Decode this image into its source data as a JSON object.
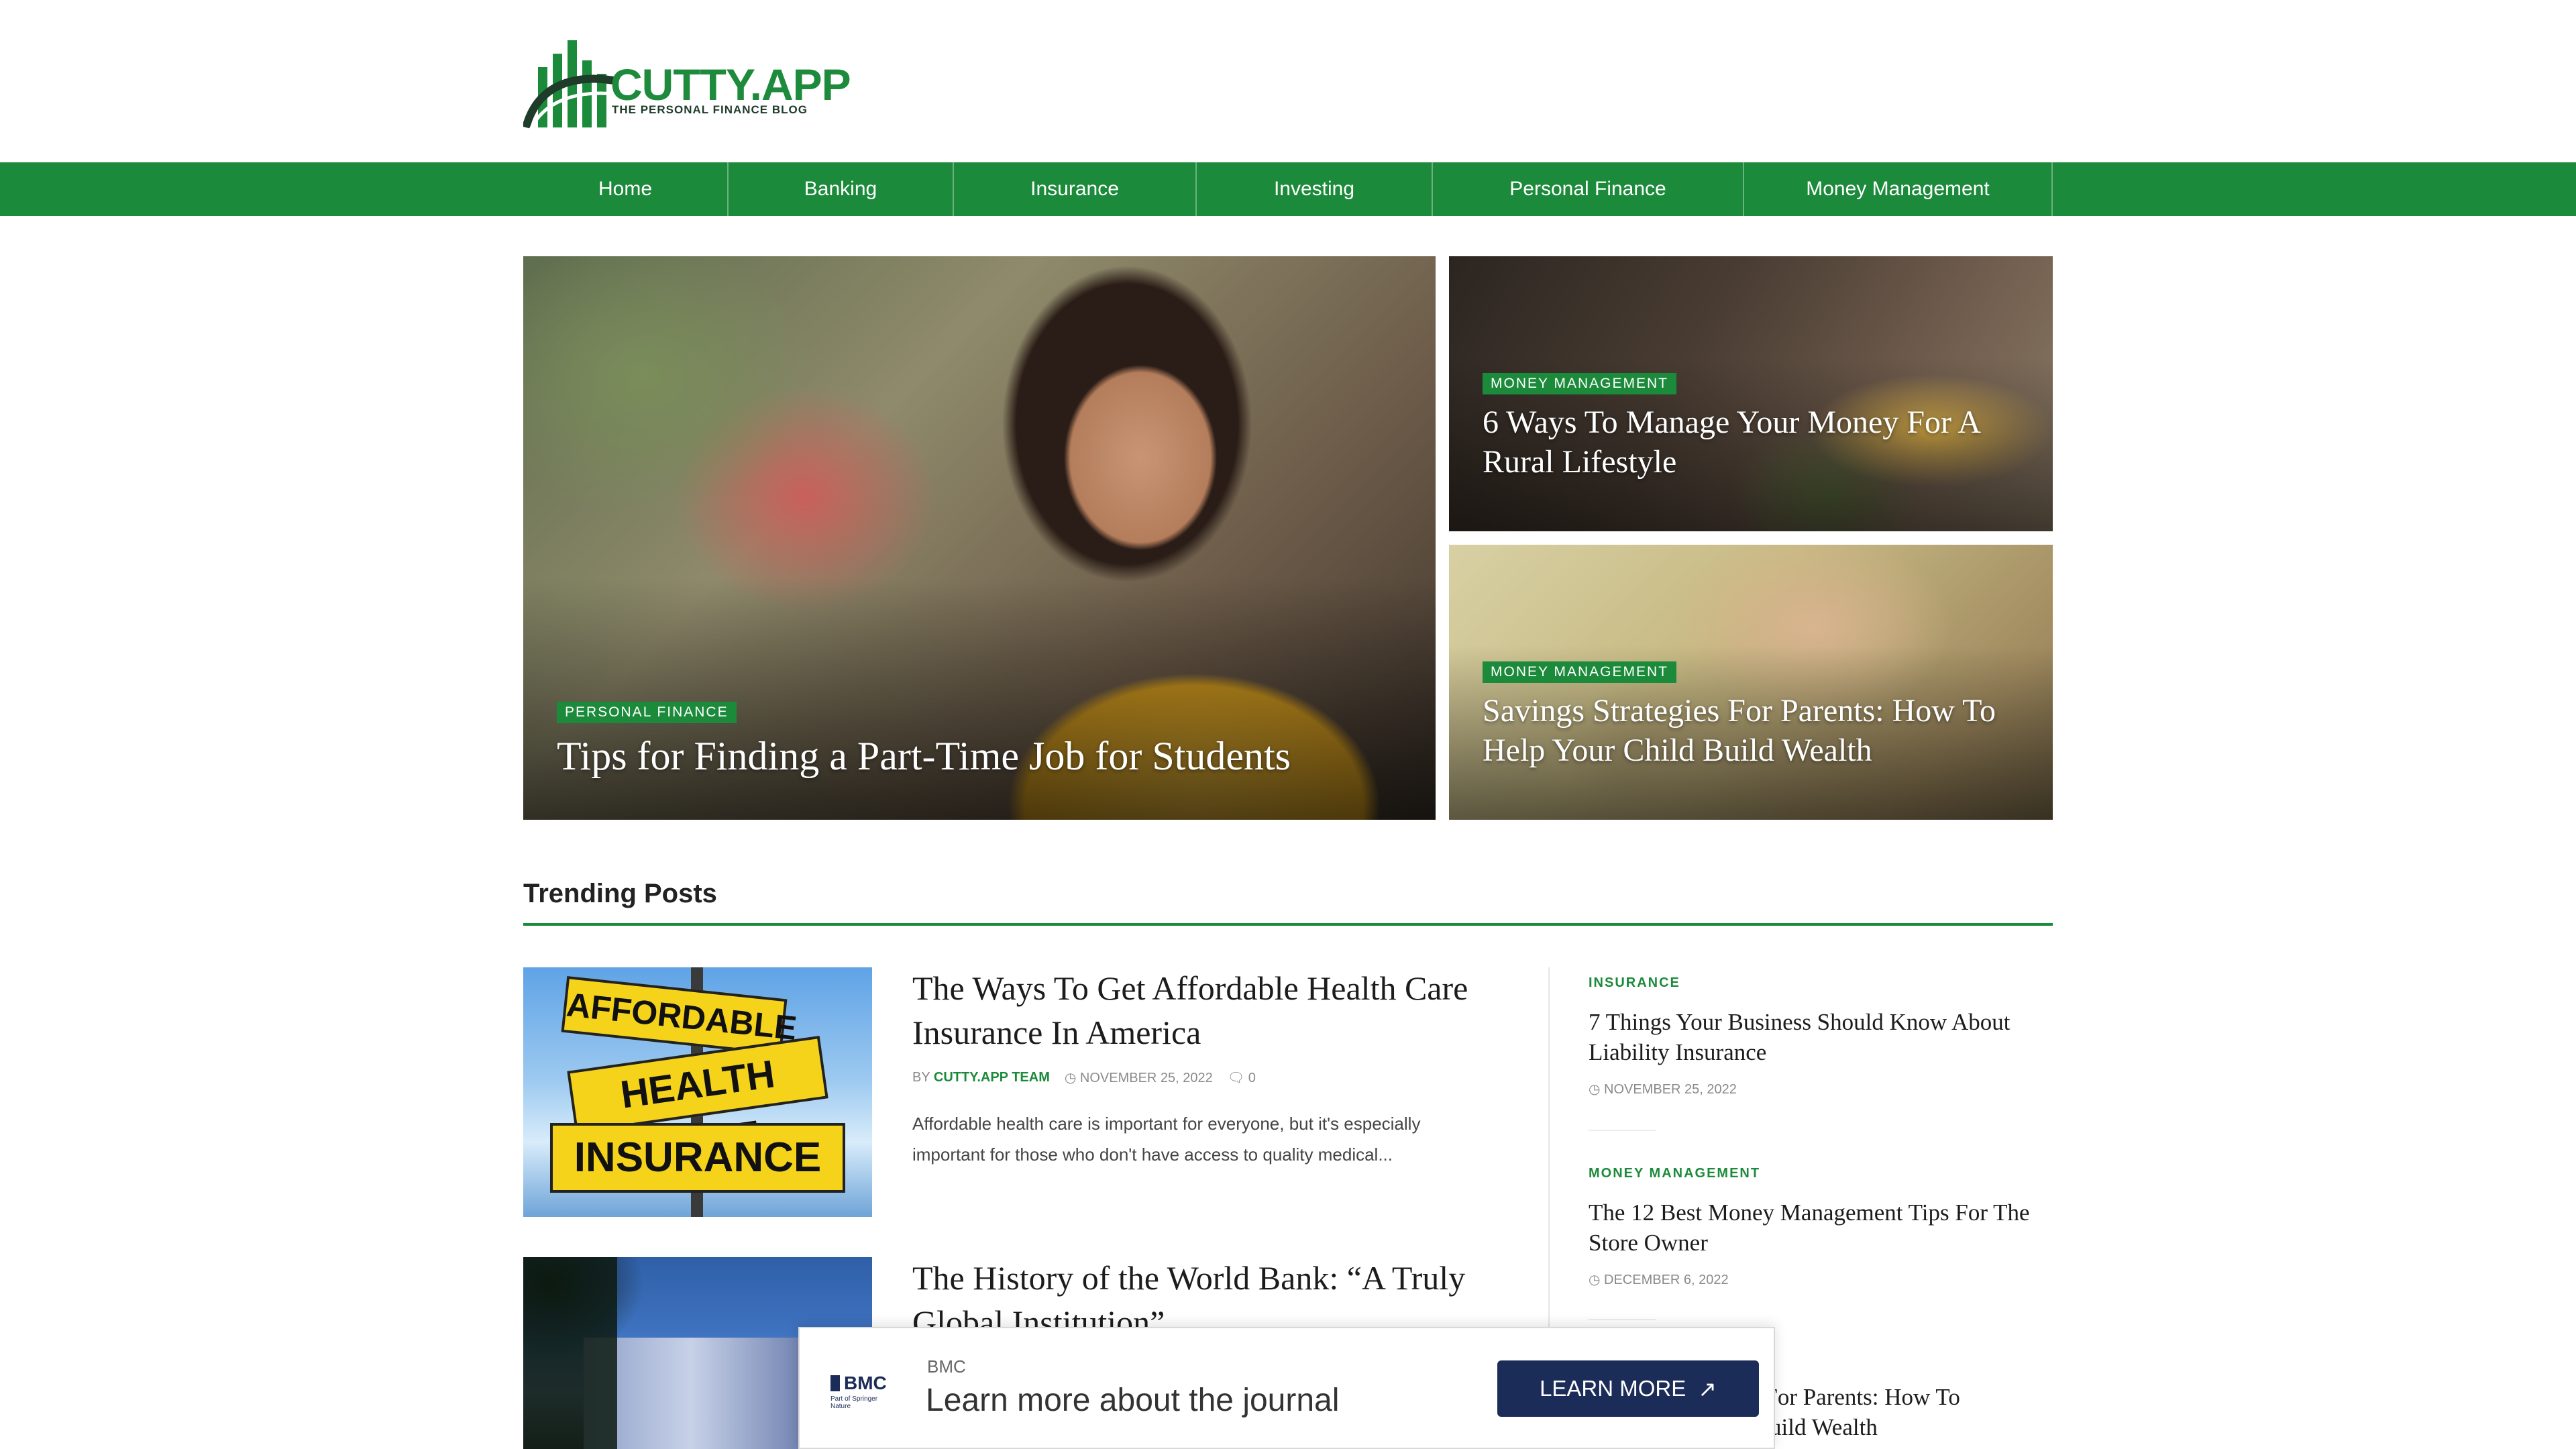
{
  "brand": {
    "name": "CUTTY.APP",
    "tagline": "THE PERSONAL FINANCE BLOG",
    "accent": "#1b8a3a"
  },
  "nav": [
    {
      "label": "Home"
    },
    {
      "label": "Banking"
    },
    {
      "label": "Insurance"
    },
    {
      "label": "Investing"
    },
    {
      "label": "Personal Finance"
    },
    {
      "label": "Money Management"
    }
  ],
  "hero": {
    "main": {
      "category": "PERSONAL FINANCE",
      "title": "Tips for Finding a Part-Time Job for Students"
    },
    "side": [
      {
        "category": "MONEY MANAGEMENT",
        "title": "6 Ways To Manage Your Money For A Rural Lifestyle"
      },
      {
        "category": "MONEY MANAGEMENT",
        "title": "Savings Strategies For Parents: How To Help Your Child Build Wealth"
      }
    ]
  },
  "trending": {
    "heading": "Trending Posts",
    "posts": [
      {
        "title": "The Ways To Get Affordable Health Care Insurance In America",
        "by": "BY",
        "author": "CUTTY.APP TEAM",
        "date": "NOVEMBER 25, 2022",
        "comments": "0",
        "excerpt": "Affordable health care is important for everyone, but it's especially important for those who don't have access to quality medical...",
        "thumb_signs": [
          "AFFORDABLE",
          "HEALTH CARE",
          "INSURANCE"
        ]
      },
      {
        "title": "The History of the World Bank: “A Truly Global Institution”"
      }
    ],
    "sidebar": [
      {
        "category": "INSURANCE",
        "title": "7 Things Your Business Should Know About Liability Insurance",
        "date": "NOVEMBER 25, 2022"
      },
      {
        "category": "MONEY MANAGEMENT",
        "title": "The 12 Best Money Management Tips For The Store Owner",
        "date": "DECEMBER 6, 2022"
      },
      {
        "title_partial_line1": "s For Parents: How To",
        "title_partial_line2": "uild Wealth"
      }
    ]
  },
  "ad": {
    "logo_text": "BMC",
    "logo_sub": "Part of Springer Nature",
    "brand": "BMC",
    "headline": "Learn more about the journal",
    "button": "LEARN MORE"
  }
}
